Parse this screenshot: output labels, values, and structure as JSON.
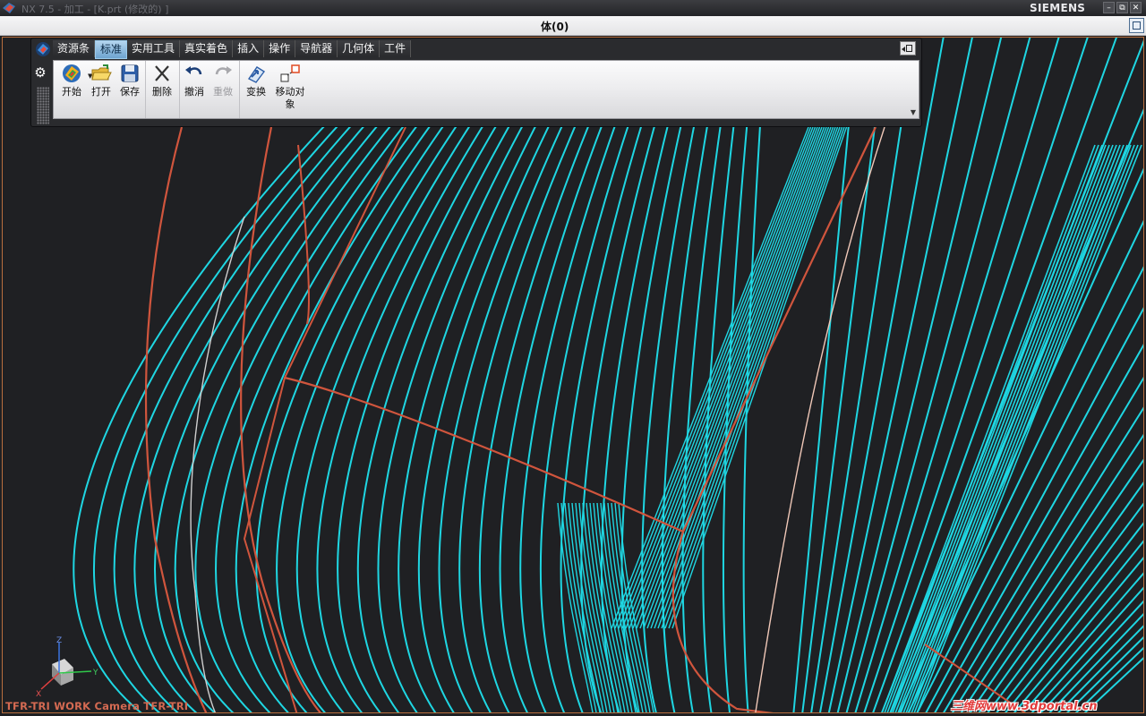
{
  "window": {
    "title": "NX 7.5 - 加工 - [K.prt (修改的) ]",
    "brand": "SIEMENS",
    "controls": {
      "minimize": "–",
      "restore": "⧉",
      "close": "✕"
    }
  },
  "status": {
    "text": "体(0)"
  },
  "toolbar": {
    "tabs": [
      {
        "label": "资源条",
        "active": false
      },
      {
        "label": "标准",
        "active": true
      },
      {
        "label": "实用工具",
        "active": false
      },
      {
        "label": "真实着色",
        "active": false
      },
      {
        "label": "插入",
        "active": false
      },
      {
        "label": "操作",
        "active": false
      },
      {
        "label": "导航器",
        "active": false
      },
      {
        "label": "几何体",
        "active": false
      },
      {
        "label": "工件",
        "active": false
      }
    ],
    "buttons": {
      "start": "开始",
      "open": "打开",
      "save": "保存",
      "delete": "删除",
      "undo": "撤消",
      "redo": "重做",
      "transform": "变换",
      "move_object": "移动对象"
    },
    "icons": [
      "nx-logo-icon",
      "gear-icon",
      "start-icon",
      "open-folder-icon",
      "save-icon",
      "delete-icon",
      "undo-icon",
      "redo-icon",
      "transform-icon",
      "move-object-icon"
    ]
  },
  "viewport": {
    "view_name": "TFR-TRI WORK Camera TFR-TRI",
    "triad_labels": {
      "x": "X",
      "y": "Y",
      "z": "Z"
    },
    "colors": {
      "background": "#1f2023",
      "toolpath": "#1fd6e2",
      "boundary": "#d0553d",
      "highlight": "#f0c8b8"
    }
  },
  "watermark": {
    "text": "三维网www.3dportal.cn"
  }
}
